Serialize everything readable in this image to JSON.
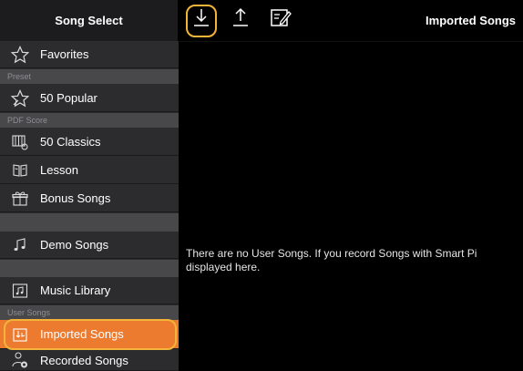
{
  "sidebar": {
    "title": "Song Select",
    "sections": {
      "preset": "Preset",
      "pdf_score": "PDF Score",
      "user_songs": "User Songs"
    },
    "items": [
      {
        "label": "Favorites",
        "icon": "star-outline-icon"
      },
      {
        "label": "50 Popular",
        "icon": "star-burst-icon"
      },
      {
        "label": "50 Classics",
        "icon": "piano-keys-icon"
      },
      {
        "label": "Lesson",
        "icon": "open-book-icon"
      },
      {
        "label": "Bonus Songs",
        "icon": "gift-icon"
      },
      {
        "label": "Demo Songs",
        "icon": "music-notes-icon"
      },
      {
        "label": "Music Library",
        "icon": "music-library-icon"
      },
      {
        "label": "Imported Songs",
        "icon": "import-icon",
        "selected": true
      },
      {
        "label": "Recorded Songs",
        "icon": "record-icon"
      }
    ]
  },
  "toolbar": {
    "import_icon": "download-tray-icon",
    "export_icon": "upload-tray-icon",
    "edit_icon": "edit-note-icon"
  },
  "main": {
    "title": "Imported Songs",
    "empty_message": "There are no User Songs. If you record Songs with Smart Pi\ndisplayed here."
  },
  "colors": {
    "selected": "#ec7a2f",
    "highlight_ring": "#f2b53a",
    "sidebar_bg": "#2c2c2e",
    "section_bg": "#48484a"
  }
}
